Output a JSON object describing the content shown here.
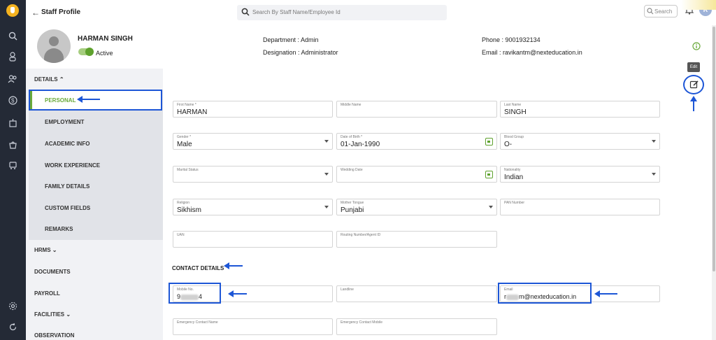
{
  "app": {
    "title": "Staff Profile",
    "search_placeholder": "Search By Staff Name/Employee Id",
    "small_search_label": "Search",
    "user_initial": "R"
  },
  "profile": {
    "name": "HARMAN SINGH",
    "status": "Active",
    "department": "Department : Admin",
    "designation": "Designation : Administrator",
    "phone": "Phone : 9001932134",
    "email": "Email : ravikantm@nexteducation.in"
  },
  "sidebar": {
    "details_label": "DETAILS",
    "details_items": [
      "PERSONAL",
      "EMPLOYMENT",
      "ACADEMIC INFO",
      "WORK EXPERIENCE",
      "FAMILY DETAILS",
      "CUSTOM FIELDS",
      "REMARKS"
    ],
    "sections": [
      "HRMS",
      "DOCUMENTS",
      "PAYROLL",
      "FACILITIES",
      "OBSERVATION"
    ]
  },
  "form": {
    "first_name_label": "First Name *",
    "first_name": "HARMAN",
    "middle_name_label": "Middle Name",
    "middle_name": "",
    "last_name_label": "Last Name",
    "last_name": "SINGH",
    "gender_label": "Gender *",
    "gender": "Male",
    "dob_label": "Date of Birth *",
    "dob": "01-Jan-1990",
    "blood_group_label": "Blood Group",
    "blood_group": "O-",
    "marital_label": "Marital Status",
    "marital": "",
    "wedding_label": "Wedding Date",
    "wedding": "",
    "nationality_label": "Nationality",
    "nationality": "Indian",
    "religion_label": "Religion",
    "religion": "Sikhism",
    "mother_tongue_label": "Mother Tongue",
    "mother_tongue": "Punjabi",
    "pan_label": "PAN Number",
    "pan": "",
    "uan_label": "UAN",
    "routing_label": "Routing Number/Agent ID"
  },
  "contact": {
    "section_title": "CONTACT DETAILS",
    "mobile_label": "Mobile No.",
    "mobile_prefix": "9",
    "mobile_suffix": "4",
    "landline_label": "Landline",
    "email_label": "Email",
    "email_prefix": "r",
    "email_suffix": "m@nexteducation.in",
    "emergency_name_label": "Emergency Contact Name",
    "emergency_mobile_label": "Emergency Contact Mobile"
  },
  "edit": {
    "tooltip": "Edit"
  },
  "colors": {
    "accent_green": "#6aaa3b",
    "highlight_blue": "#1d56d6",
    "rail_bg": "#242a36"
  }
}
